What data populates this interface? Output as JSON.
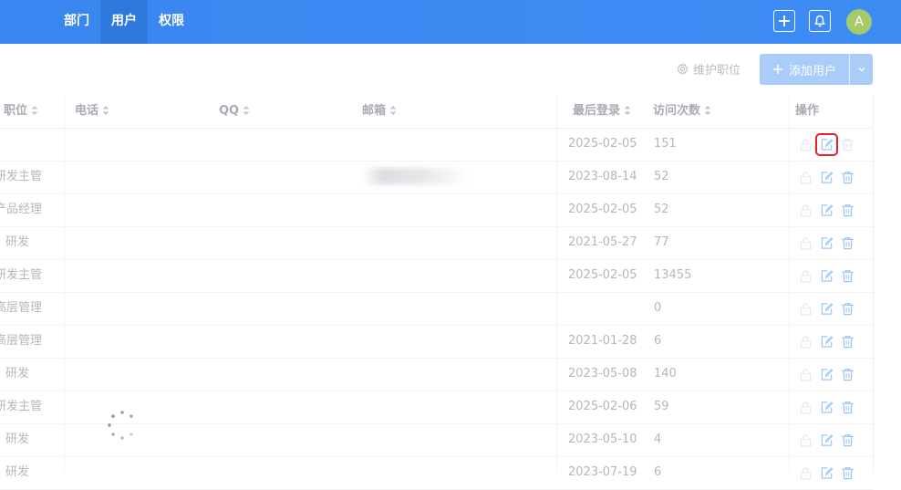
{
  "nav": {
    "items": [
      {
        "label": "部门",
        "active": false
      },
      {
        "label": "用户",
        "active": true
      },
      {
        "label": "权限",
        "active": false
      }
    ],
    "avatar_initial": "A"
  },
  "toolbar": {
    "maintain_positions_label": "维护职位",
    "add_user_label": "添加用户"
  },
  "table": {
    "columns": {
      "position": "职位",
      "phone": "电话",
      "qq": "QQ",
      "email": "邮箱",
      "last_login": "最后登录",
      "visits": "访问次数",
      "actions": "操作"
    },
    "rows": [
      {
        "position": "",
        "last_login": "2025-02-05",
        "visits": "151"
      },
      {
        "position": "研发主管",
        "last_login": "2023-08-14",
        "visits": "52"
      },
      {
        "position": "产品经理",
        "last_login": "2025-02-05",
        "visits": "52"
      },
      {
        "position": "研发",
        "last_login": "2021-05-27",
        "visits": "77"
      },
      {
        "position": "研发主管",
        "last_login": "2025-02-05",
        "visits": "13455"
      },
      {
        "position": "高层管理",
        "last_login": "",
        "visits": "0"
      },
      {
        "position": "高层管理",
        "last_login": "2021-01-28",
        "visits": "6"
      },
      {
        "position": "研发",
        "last_login": "2023-05-08",
        "visits": "140"
      },
      {
        "position": "研发主管",
        "last_login": "2025-02-06",
        "visits": "59"
      },
      {
        "position": "研发",
        "last_login": "2023-05-10",
        "visits": "4"
      },
      {
        "position": "研发",
        "last_login": "2023-07-19",
        "visits": "6"
      }
    ]
  },
  "colors": {
    "topbar": "#3d8cf4",
    "nav_active": "#2f78dc",
    "avatar": "#a6c96b",
    "primary_disabled": "#a9cdf8",
    "highlight_box": "#e8202a"
  },
  "icons": [
    "plus-icon",
    "bell-icon",
    "gear-icon",
    "chevron-down-icon",
    "lock-icon",
    "edit-icon",
    "trash-icon",
    "sort-icon",
    "loading-spinner-icon"
  ]
}
